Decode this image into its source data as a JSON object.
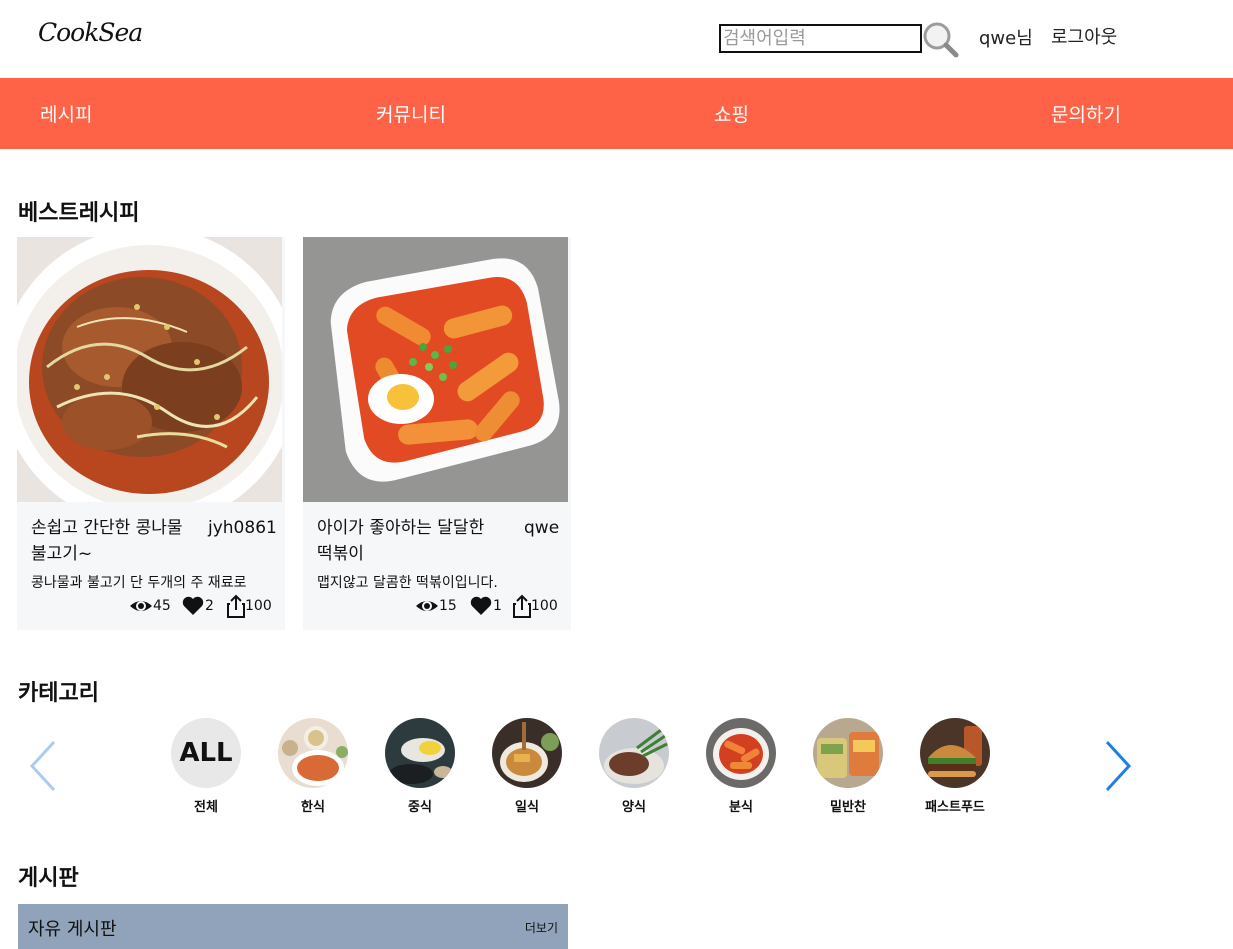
{
  "header": {
    "logo": "CookSea",
    "search_placeholder": "검색어입력",
    "user_name": "qwe님",
    "logout_label": "로그아웃"
  },
  "nav": {
    "items": [
      {
        "label": "레시피"
      },
      {
        "label": "커뮤니티"
      },
      {
        "label": "쇼핑"
      },
      {
        "label": "문의하기"
      }
    ]
  },
  "best_recipes": {
    "title": "베스트레시피",
    "cards": [
      {
        "title": "손쉽고 간단한 콩나물 불고기~",
        "author": "jyh0861",
        "description": "콩나물과 불고기 단 두개의 주 재료로",
        "views": "45",
        "likes": "2",
        "shares": "100"
      },
      {
        "title": "아이가 좋아하는 달달한 떡볶이",
        "author": "qwe",
        "description": "맵지않고 달콤한 떡볶이입니다.",
        "views": "15",
        "likes": "1",
        "shares": "100"
      }
    ]
  },
  "categories": {
    "title": "카테고리",
    "all_badge": "ALL",
    "items": [
      {
        "label": "전체"
      },
      {
        "label": "한식"
      },
      {
        "label": "중식"
      },
      {
        "label": "일식"
      },
      {
        "label": "양식"
      },
      {
        "label": "분식"
      },
      {
        "label": "밑반찬"
      },
      {
        "label": "패스트푸드"
      }
    ]
  },
  "board": {
    "title": "게시판",
    "free_board": "자유 게시판",
    "more_label": "더보기"
  },
  "colors": {
    "nav_bg": "#ff6347",
    "board_bar": "#91a3bb",
    "arrow_left": "#a9cdf2",
    "arrow_right": "#1e80e6"
  },
  "icons": [
    "search-icon",
    "eye-icon",
    "heart-icon",
    "share-icon",
    "chevron-left-icon",
    "chevron-right-icon"
  ]
}
